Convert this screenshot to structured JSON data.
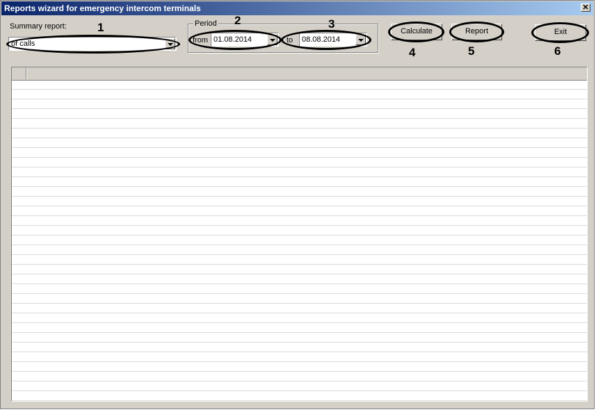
{
  "window": {
    "title": "Reports wizard for emergency intercom terminals",
    "close_glyph": "✕"
  },
  "summary": {
    "label": "Summary report:",
    "value": "of calls"
  },
  "period": {
    "legend": "Period",
    "from_label": "from",
    "from_value": "01.08.2014",
    "to_label": "to",
    "to_value": "08.08.2014"
  },
  "buttons": {
    "calculate": "Calculate",
    "report": "Report",
    "exit": "Exit"
  },
  "callouts": [
    "1",
    "2",
    "3",
    "4",
    "5",
    "6"
  ],
  "grid": {
    "rows": []
  }
}
